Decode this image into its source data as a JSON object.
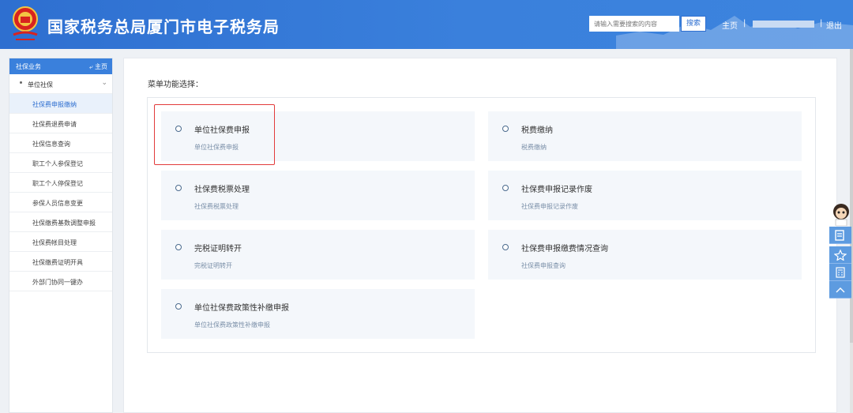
{
  "header": {
    "site_title": "国家税务总局厦门市电子税务局",
    "search_placeholder": "请输入需要搜索的内容",
    "search_button": "搜索",
    "nav_home": "主页",
    "separator": "|",
    "logout": "退出",
    "brand_color": "#3a80dc"
  },
  "sidebar": {
    "title": "社保业务",
    "home_link": "主页",
    "group_label": "单位社保",
    "items": [
      {
        "label": "社保费申报缴纳",
        "active": true
      },
      {
        "label": "社保费退费申请",
        "active": false
      },
      {
        "label": "社保信息查询",
        "active": false
      },
      {
        "label": "职工个人参保登记",
        "active": false
      },
      {
        "label": "职工个人停保登记",
        "active": false
      },
      {
        "label": "参保人员信息变更",
        "active": false
      },
      {
        "label": "社保缴费基数调整申报",
        "active": false
      },
      {
        "label": "社保费帐目处理",
        "active": false
      },
      {
        "label": "社保缴费证明开具",
        "active": false
      },
      {
        "label": "外部门协同一键办",
        "active": false
      }
    ]
  },
  "main": {
    "menu_title": "菜单功能选择：",
    "cards": [
      {
        "title": "单位社保费申报",
        "subtitle": "单位社保费申报"
      },
      {
        "title": "税费缴纳",
        "subtitle": "税费缴纳"
      },
      {
        "title": "社保费税票处理",
        "subtitle": "社保费税票处理"
      },
      {
        "title": "社保费申报记录作废",
        "subtitle": "社保费申报记录作废"
      },
      {
        "title": "完税证明转开",
        "subtitle": "完税证明转开"
      },
      {
        "title": "社保费申报缴费情况查询",
        "subtitle": "社保费申报查询"
      },
      {
        "title": "单位社保费政策性补缴申报",
        "subtitle": "单位社保费政策性补缴申报"
      }
    ],
    "highlight_color": "#e23b3b"
  },
  "float_toolbar": {
    "icons": [
      "mascot-icon",
      "document-icon",
      "star-icon",
      "calculator-icon",
      "chevron-up-icon"
    ]
  }
}
